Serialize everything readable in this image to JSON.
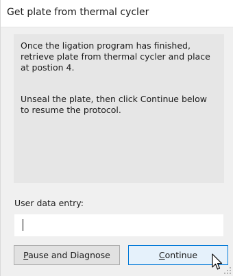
{
  "dialog": {
    "title": "Get plate from thermal cycler"
  },
  "message": {
    "paragraph1": "Once the ligation program has finished, retrieve plate from thermal cycler and place at postion 4.",
    "paragraph2": "Unseal the plate, then click Continue below to resume the protocol."
  },
  "entry": {
    "label": "User data entry:",
    "value": ""
  },
  "buttons": {
    "pause_label": "Pause and Diagnose",
    "continue_label": "Continue"
  },
  "colors": {
    "accent_border": "#0078d7",
    "accent_fill": "#e5f1fb",
    "dialog_background": "#f0f0f0",
    "panel_background": "#e6e6e6"
  },
  "icons": {
    "pointer": "mouse-pointer-icon",
    "resize_grip": "resize-grip-icon"
  }
}
